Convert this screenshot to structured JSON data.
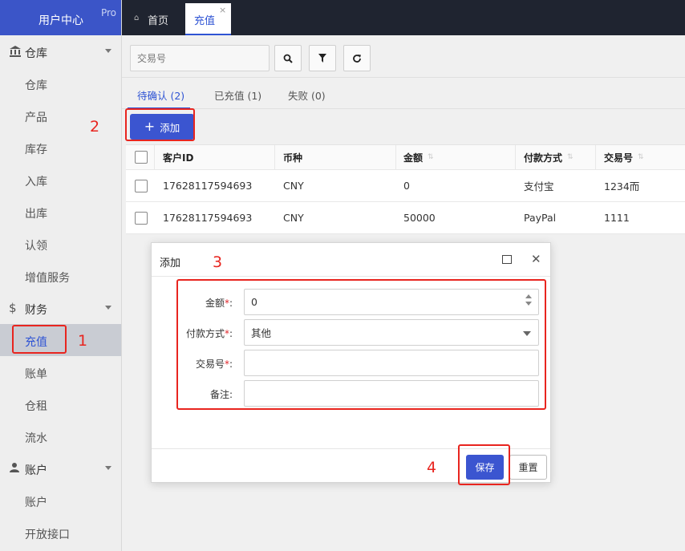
{
  "brand": {
    "title": "用户中心",
    "badge": "Pro"
  },
  "sidebar": {
    "groups": [
      {
        "label": "仓库",
        "icon": "bank-icon",
        "items": [
          "仓库",
          "产品",
          "库存",
          "入库",
          "出库",
          "认领",
          "增值服务"
        ]
      },
      {
        "label": "财务",
        "icon": "dollar-icon",
        "items": [
          "充值",
          "账单",
          "仓租",
          "流水"
        ]
      },
      {
        "label": "账户",
        "icon": "user-icon",
        "items": [
          "账户",
          "开放接口"
        ]
      }
    ],
    "active_item": "充值"
  },
  "topbar": {
    "home_label": "首页",
    "active_tab_label": "充值",
    "close_glyph": "×"
  },
  "search": {
    "placeholder": "交易号"
  },
  "status_tabs": [
    {
      "label": "待确认 (2)",
      "active": true
    },
    {
      "label": "已充值 (1)",
      "active": false
    },
    {
      "label": "失败 (0)",
      "active": false
    }
  ],
  "add_button": {
    "label": "添加",
    "plus": "+"
  },
  "table": {
    "columns": [
      "客户ID",
      "币种",
      "金额",
      "付款方式",
      "交易号"
    ],
    "sortable": [
      false,
      false,
      true,
      true,
      true
    ],
    "rows": [
      [
        "17628117594693",
        "CNY",
        "0",
        "支付宝",
        "1234而"
      ],
      [
        "17628117594693",
        "CNY",
        "50000",
        "PayPal",
        "1111"
      ]
    ]
  },
  "dialog": {
    "title": "添加",
    "fields": [
      {
        "label": "金额",
        "required": true,
        "value": "0",
        "type": "number"
      },
      {
        "label": "付款方式",
        "required": true,
        "value": "其他",
        "type": "select"
      },
      {
        "label": "交易号",
        "required": true,
        "value": "",
        "type": "text"
      },
      {
        "label": "备注",
        "required": false,
        "value": "",
        "type": "text"
      }
    ],
    "save_label": "保存",
    "reset_label": "重置",
    "required_mark": "*",
    "colon": ":"
  },
  "annotations": [
    "1",
    "2",
    "3",
    "4"
  ],
  "colors": {
    "accent": "#3b55d0",
    "sidebar_active": "#c9ccd3",
    "topbar": "#1f2430",
    "annotation": "#e8251f"
  }
}
